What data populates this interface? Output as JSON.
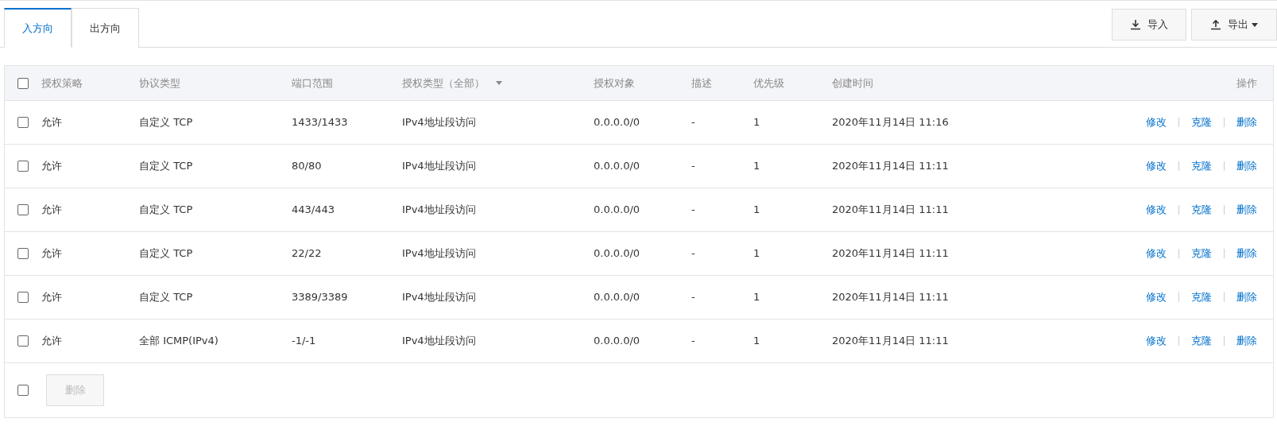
{
  "tabs": [
    {
      "label": "入方向",
      "selected": true
    },
    {
      "label": "出方向",
      "selected": false
    }
  ],
  "toolbar": {
    "import_button": "导入",
    "export_button": "导出"
  },
  "table": {
    "columns": [
      "授权策略",
      "协议类型",
      "端口范围",
      "授权类型（全部）",
      "授权对象",
      "描述",
      "优先级",
      "创建时间",
      "操作"
    ],
    "header_checked": false,
    "rows": [
      {
        "checked": false,
        "cells": [
          "允许",
          "自定义 TCP",
          "1433/1433",
          "IPv4地址段访问",
          "0.0.0.0/0",
          "-",
          "1",
          "2020年11月14日 11:16"
        ],
        "actions": [
          "修改",
          "克隆",
          "删除"
        ]
      },
      {
        "checked": false,
        "cells": [
          "允许",
          "自定义 TCP",
          "80/80",
          "IPv4地址段访问",
          "0.0.0.0/0",
          "-",
          "1",
          "2020年11月14日 11:11"
        ],
        "actions": [
          "修改",
          "克隆",
          "删除"
        ]
      },
      {
        "checked": false,
        "cells": [
          "允许",
          "自定义 TCP",
          "443/443",
          "IPv4地址段访问",
          "0.0.0.0/0",
          "-",
          "1",
          "2020年11月14日 11:11"
        ],
        "actions": [
          "修改",
          "克隆",
          "删除"
        ]
      },
      {
        "checked": false,
        "cells": [
          "允许",
          "自定义 TCP",
          "22/22",
          "IPv4地址段访问",
          "0.0.0.0/0",
          "-",
          "1",
          "2020年11月14日 11:11"
        ],
        "actions": [
          "修改",
          "克隆",
          "删除"
        ]
      },
      {
        "checked": false,
        "cells": [
          "允许",
          "自定义 TCP",
          "3389/3389",
          "IPv4地址段访问",
          "0.0.0.0/0",
          "-",
          "1",
          "2020年11月14日 11:11"
        ],
        "actions": [
          "修改",
          "克隆",
          "删除"
        ]
      },
      {
        "checked": false,
        "cells": [
          "允许",
          "全部 ICMP(IPv4)",
          "-1/-1",
          "IPv4地址段访问",
          "0.0.0.0/0",
          "-",
          "1",
          "2020年11月14日 11:11"
        ],
        "actions": [
          "修改",
          "克隆",
          "删除"
        ]
      }
    ]
  },
  "footer": {
    "select_all_checked": false,
    "delete_button": {
      "label": "删除",
      "disabled": true
    }
  }
}
